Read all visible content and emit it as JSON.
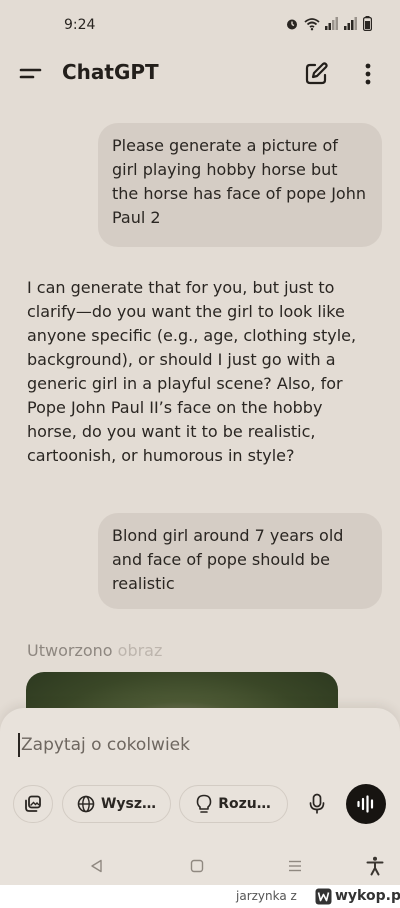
{
  "status_bar": {
    "time": "9:24"
  },
  "header": {
    "title": "ChatGPT"
  },
  "messages": {
    "user_1": "Please generate a picture of girl playing hobby horse but the horse has face of pope John Paul 2",
    "assistant_1": "I can generate that for you, but just to clarify—do you want the girl to look like anyone specific (e.g., age, clothing style, background), or should I just go with a generic girl in a playful scene? Also, for Pope John Paul II’s face on the hobby horse, do you want it to be realistic, cartoonish, or humorous in style?",
    "user_2": "Blond girl around 7 years old and face of pope should be realistic",
    "created_label_main": "Utworzono",
    "created_label_fade": " obraz"
  },
  "composer": {
    "placeholder": "Zapytaj o cokolwiek",
    "search_label": "Wysz…",
    "reason_label": "Rozu…"
  },
  "footer": {
    "author": "jarzynka z",
    "brand": "wykop.pl"
  }
}
